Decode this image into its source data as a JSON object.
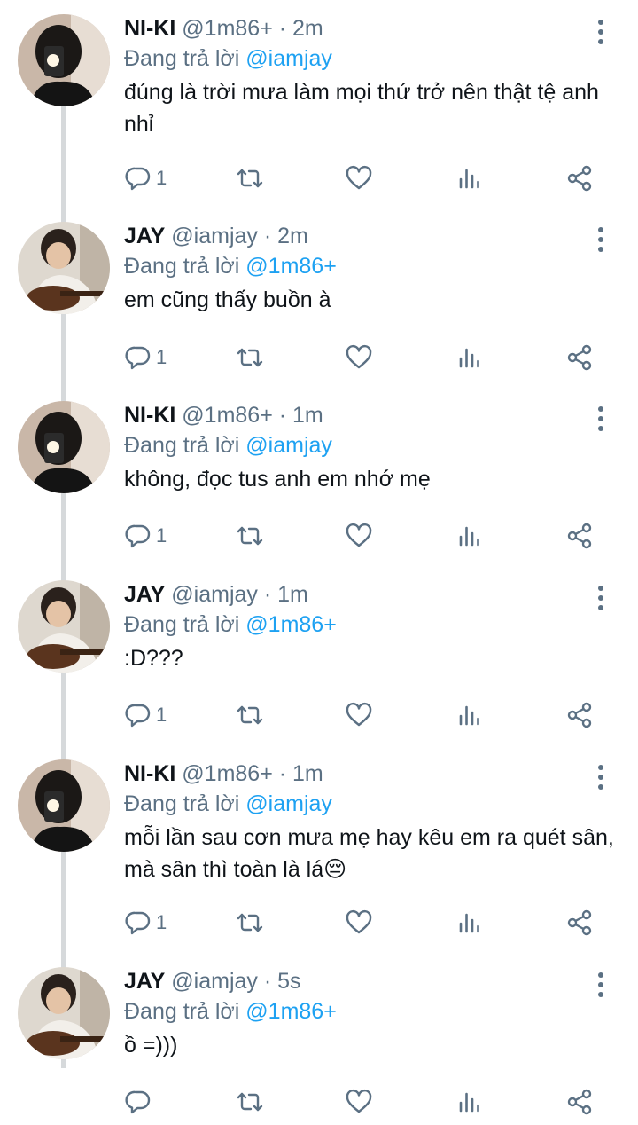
{
  "replying_prefix": "Đang trả lời",
  "tweets": [
    {
      "name": "NI-KI",
      "meta": "@1m86+ · 2m",
      "replying_to": "@iamjay",
      "text": "đúng là trời mưa làm mọi thứ trở nên thật tệ anh nhỉ",
      "reply_count": "1"
    },
    {
      "name": "JAY",
      "meta": "@iamjay · 2m",
      "replying_to": "@1m86+",
      "text": "em cũng thấy buồn à",
      "reply_count": "1"
    },
    {
      "name": "NI-KI",
      "meta": "@1m86+ · 1m",
      "replying_to": "@iamjay",
      "text": "không, đọc tus anh em nhớ mẹ",
      "reply_count": "1"
    },
    {
      "name": "JAY",
      "meta": "@iamjay · 1m",
      "replying_to": "@1m86+",
      "text": ":D???",
      "reply_count": "1"
    },
    {
      "name": "NI-KI",
      "meta": "@1m86+ · 1m",
      "replying_to": "@iamjay",
      "text": "mỗi lần sau cơn mưa mẹ hay kêu em ra quét sân, mà sân thì toàn là lá😔",
      "reply_count": "1"
    },
    {
      "name": "JAY",
      "meta": "@iamjay · 5s",
      "replying_to": "@1m86+",
      "text": "ồ =)))",
      "reply_count": ""
    }
  ],
  "icons": {
    "reply": "reply-icon",
    "retweet": "retweet-icon",
    "like": "heart-icon",
    "analytics": "analytics-icon",
    "share": "share-icon",
    "more": "more-vertical-icon"
  },
  "colors": {
    "name": "#0f1419",
    "secondary": "#5b7083",
    "mention": "#1da1f2",
    "thread_line": "#d6d9db"
  }
}
